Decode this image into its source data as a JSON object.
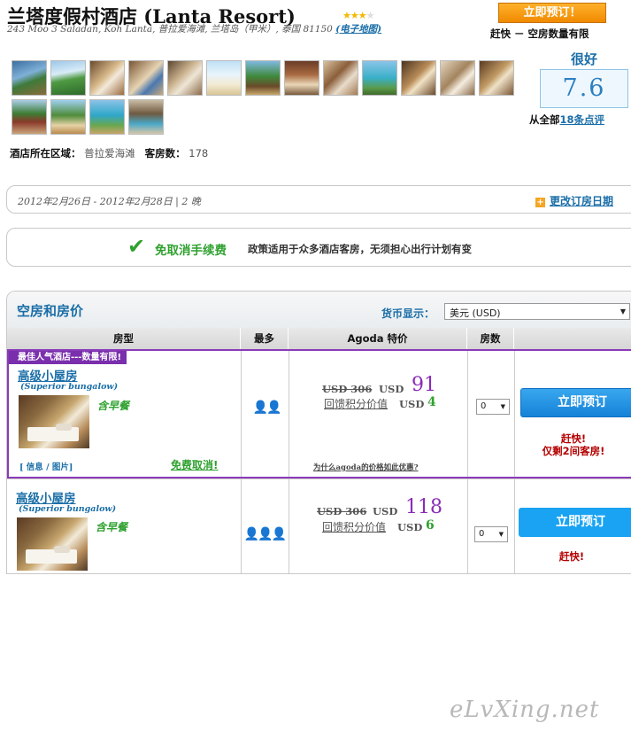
{
  "hotel": {
    "title": "兰塔度假村酒店 (Lanta Resort)",
    "stars": "★★★",
    "half_star": "★",
    "address": "243 Moo 3 Saladan, Koh Lanta, 普拉爱海滩, 兰塔岛（甲米）, 泰国 81150",
    "map_link": "(电子地图)",
    "area_label": "酒店所在区域：",
    "area_value": "普拉爱海滩",
    "rooms_label": "客房数：",
    "rooms_value": "178"
  },
  "header_actions": {
    "book_now": "立即预订！",
    "hurry": "赶快 － 空房数量有限"
  },
  "rating": {
    "label": "很好",
    "score": "7.6",
    "reviews_prefix": "从全部",
    "reviews_link": "18条点评"
  },
  "gallery_icons": [
    "hotel-photo-icon"
  ],
  "stay": {
    "dates": "2012年2月26日 - 2012年2月28日 | 2 晚",
    "change_icon": "+",
    "change_label": "更改订房日期"
  },
  "free_cancel": {
    "check_icon": "✔",
    "title": "免取消手续费",
    "description": "政策适用于众多酒店客房，无须担心出行计划有变"
  },
  "availability": {
    "title": "空房和房价",
    "currency_label": "货币显示：",
    "currency_value": "美元 (USD)",
    "columns": [
      "房型",
      "最多",
      "Agoda 特价",
      "房数"
    ],
    "rooms": [
      {
        "tag": "最佳人气酒店---数量有限!",
        "name": "高级小屋房",
        "name_en": "(Superior bungalow)",
        "breakfast": "含早餐",
        "info_link": "[ 信息 / 图片]",
        "free_cancel": "免费取消!",
        "max_persons": "👤👤",
        "old_price": "USD 306",
        "currency": "USD",
        "price": "91",
        "reward_label": "回馈积分价值",
        "reward_currency": "USD",
        "reward_value": "4",
        "why_link": "为什么agoda的价格如此优惠?",
        "qty": "0",
        "book": "立即预订",
        "urgent_1": "赶快!",
        "urgent_2": "仅剩2间客房!"
      },
      {
        "name": "高级小屋房",
        "name_en": "(Superior bungalow)",
        "breakfast": "含早餐",
        "max_persons": "👤👤👤",
        "old_price": "USD 306",
        "currency": "USD",
        "price": "118",
        "reward_label": "回馈积分价值",
        "reward_currency": "USD",
        "reward_value": "6",
        "qty": "0",
        "book": "立即预订",
        "urgent_1": "赶快!"
      }
    ]
  },
  "watermark": "eLvXing.net",
  "colors": {
    "link_blue": "#1a6ea8",
    "price_purple": "#8a2bb8",
    "green": "#2fa12f",
    "orange": "#f08a00",
    "urgent_red": "#b30000"
  }
}
